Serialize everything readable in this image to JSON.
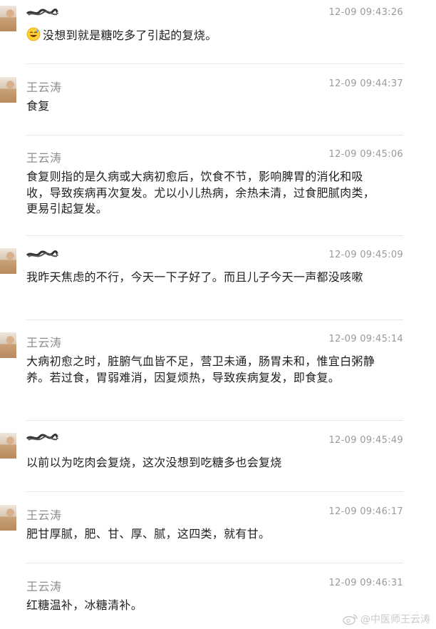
{
  "messages": [
    {
      "sender": "",
      "time": "12-09 09:43:26",
      "text": "没想到就是糖吃多了引起的复烧。",
      "emoji": "sweat-smile-emoji"
    },
    {
      "sender": "王云涛",
      "time": "12-09 09:44:37",
      "text": "食复"
    },
    {
      "sender": "王云涛",
      "time": "12-09 09:45:06",
      "text": "食复则指的是久病或大病初愈后，饮食不节，影响脾胃的消化和吸收，导致疾病再次复发。尤以小儿热病，余热未清，过食肥腻肉类，更易引起复发。"
    },
    {
      "sender": "",
      "time": "12-09 09:45:09",
      "text": "我昨天焦虑的不行，今天一下子好了。而且儿子今天一声都没咳嗽"
    },
    {
      "sender": "王云涛",
      "time": "12-09 09:45:14",
      "text": "大病初愈之时，脏腑气血皆不足，营卫未通，肠胃未和，惟宜白粥静养。若过食，胃弱难消，因复烦热，导致疾病复发，即食复。"
    },
    {
      "sender": "",
      "time": "12-09 09:45:49",
      "text": "以前以为吃肉会复烧，这次没想到吃糖多也会复烧"
    },
    {
      "sender": "王云涛",
      "time": "12-09 09:46:17",
      "text": "肥甘厚腻，肥、甘、厚、腻，这四类，就有甘。"
    },
    {
      "sender": "王云涛",
      "time": "12-09 09:46:31",
      "text": "红糖温补，冰糖清补。"
    }
  ],
  "watermark": "@中医师王云涛",
  "icons": {
    "watermark": "weibo-icon"
  },
  "colors": {
    "name": "#8e8e8e",
    "time": "#9a9a9a",
    "text": "#1f1f1f",
    "divider": "#e6e6e6"
  }
}
